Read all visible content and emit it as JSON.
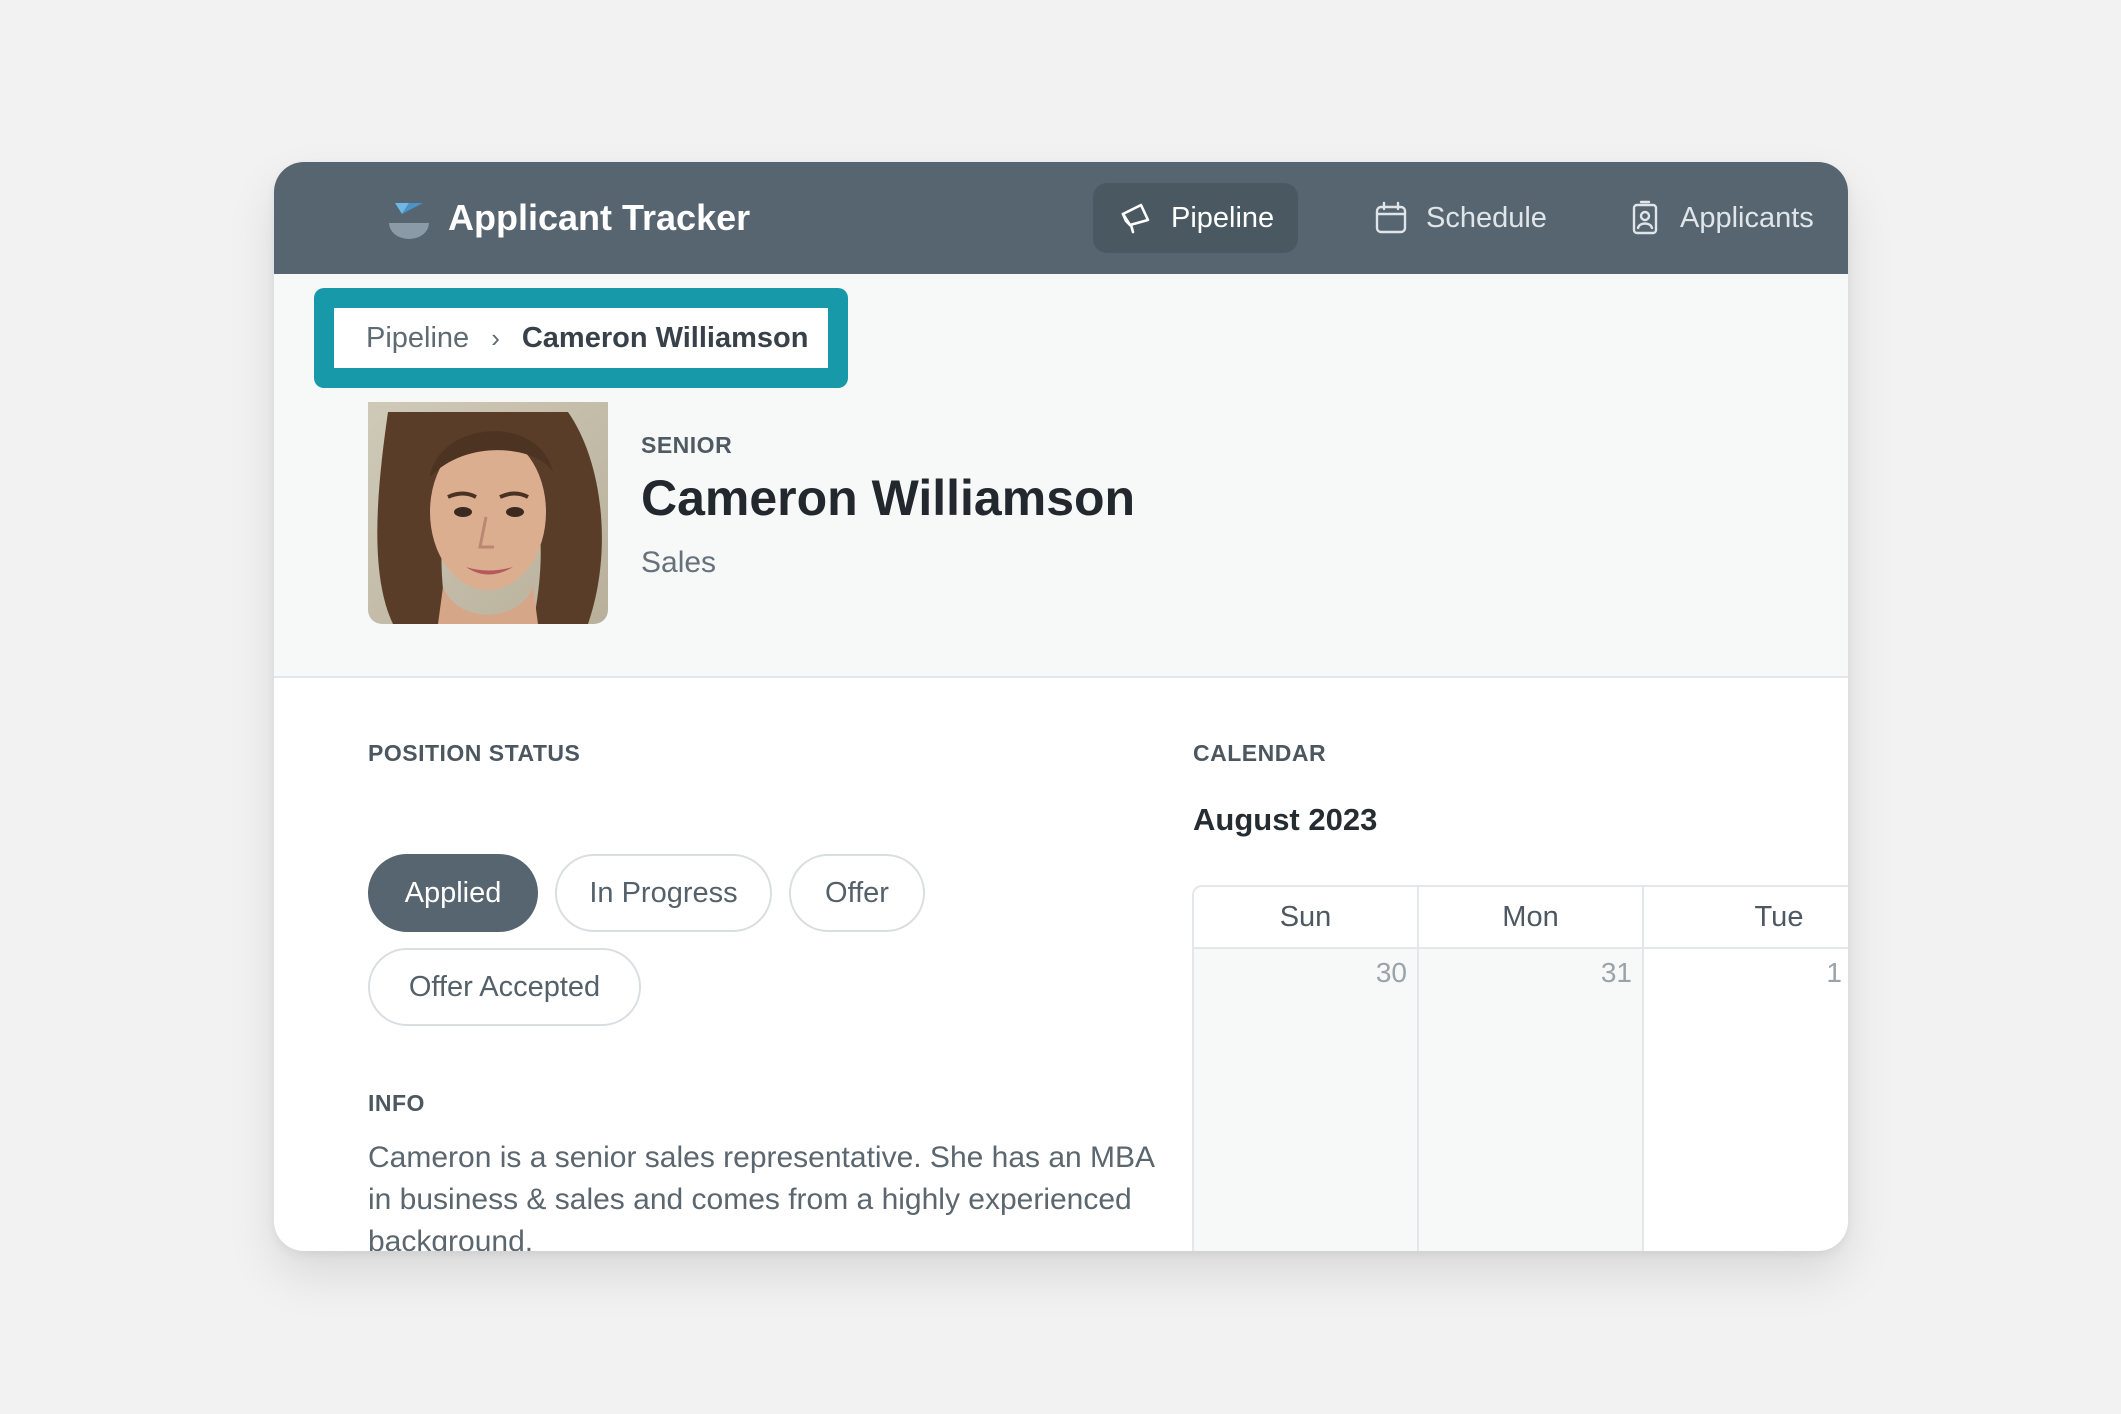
{
  "app": {
    "title": "Applicant Tracker"
  },
  "nav": [
    {
      "label": "Pipeline",
      "icon": "megaphone-icon",
      "active": true
    },
    {
      "label": "Schedule",
      "icon": "calendar-icon",
      "active": false
    },
    {
      "label": "Applicants",
      "icon": "contact-badge-icon",
      "active": false
    }
  ],
  "breadcrumb": {
    "parent": "Pipeline",
    "separator": "›",
    "current": "Cameron Williamson"
  },
  "candidate": {
    "level": "SENIOR",
    "name": "Cameron Williamson",
    "department": "Sales"
  },
  "position_status": {
    "label": "POSITION STATUS",
    "options": [
      "Applied",
      "In Progress",
      "Offer",
      "Offer Accepted"
    ],
    "selected": "Applied"
  },
  "info": {
    "label": "INFO",
    "text": "Cameron is a senior sales representative. She has an MBA in business & sales and comes from a highly experienced background."
  },
  "calendar": {
    "label": "CALENDAR",
    "month": "August 2023",
    "weekdays": [
      "Sun",
      "Mon",
      "Tue"
    ],
    "dates": [
      "30",
      "31",
      "1"
    ]
  },
  "colors": {
    "topbar": "#566570",
    "highlight_border": "#1799a9",
    "active_pill": "#566570",
    "page_background": "#f2f2f2"
  }
}
